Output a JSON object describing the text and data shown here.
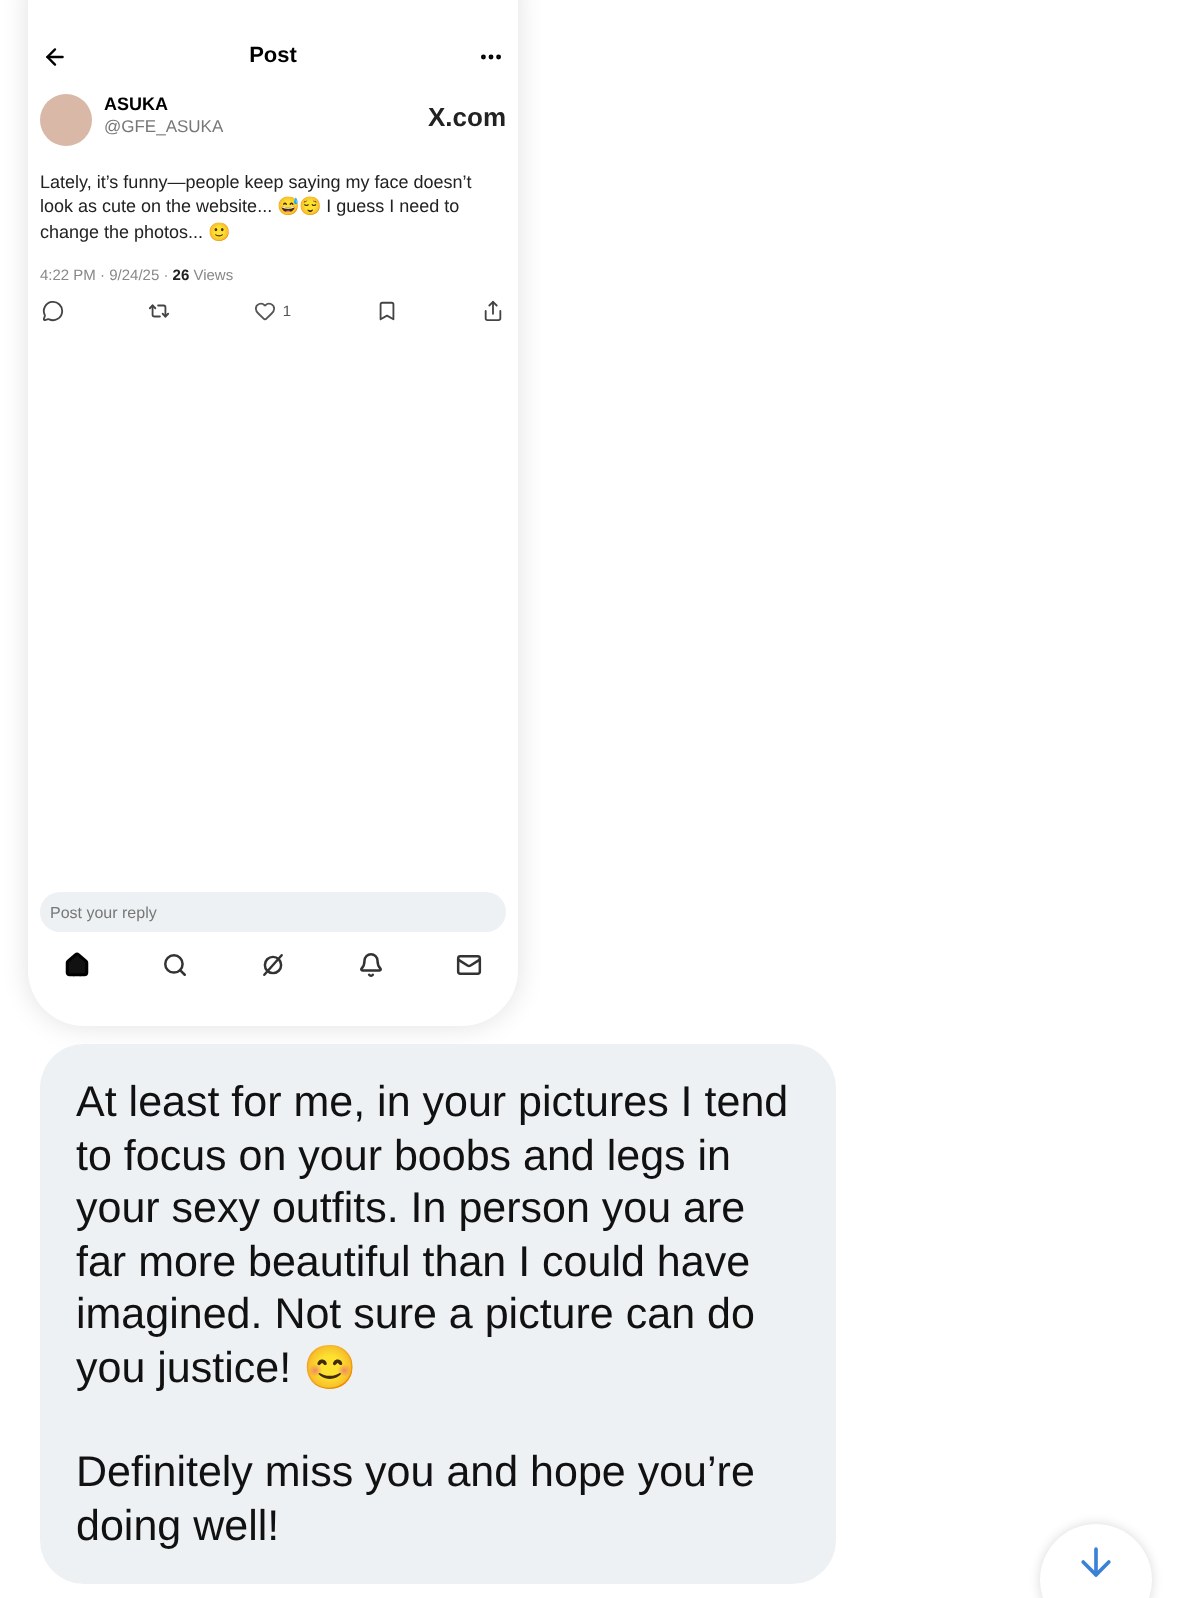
{
  "post_screenshot": {
    "header": {
      "title": "Post"
    },
    "author": {
      "name": "ASUKA",
      "handle": "@GFE_ASUKA"
    },
    "source": "X.com",
    "text": "Lately, it’s funny—people keep saying my face doesn’t look as cute on the website... 😅😌 I guess I need to change the photos... 🙂",
    "meta": {
      "time": "4:22 PM · 9/24/25 · ",
      "views_count": "26",
      "views_label": " Views"
    },
    "actions": [
      {
        "kind": "reply"
      },
      {
        "kind": "repost"
      },
      {
        "kind": "like",
        "count": "1"
      },
      {
        "kind": "bookmark"
      },
      {
        "kind": "share"
      }
    ],
    "reply": {
      "placeholder": "Post your reply"
    },
    "nav": [
      {
        "kind": "home",
        "selected": true
      },
      {
        "kind": "search",
        "selected": false
      },
      {
        "kind": "grok",
        "selected": false
      },
      {
        "kind": "bell",
        "selected": false
      },
      {
        "kind": "mail",
        "selected": false
      }
    ]
  },
  "message": {
    "paragraphs": [
      "At least for me, in your pictures I tend to focus on your boobs and legs in your sexy outfits. In person you are far more beautiful than I could have imagined. Not sure a picture can do you justice! 😊",
      "Definitely miss you and hope you’re doing well!"
    ]
  }
}
